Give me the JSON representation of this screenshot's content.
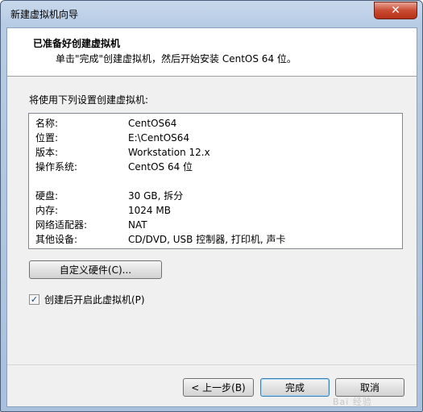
{
  "window": {
    "title": "新建虚拟机向导"
  },
  "header": {
    "title": "已准备好创建虚拟机",
    "subtitle": "单击\"完成\"创建虚拟机，然后开始安装 CentOS 64 位。"
  },
  "intro": "将使用下列设置创建虚拟机:",
  "settings": [
    {
      "label": "名称:",
      "value": "CentOS64"
    },
    {
      "label": "位置:",
      "value": "E:\\CentOS64"
    },
    {
      "label": "版本:",
      "value": "Workstation 12.x"
    },
    {
      "label": "操作系统:",
      "value": "CentOS 64 位"
    },
    {
      "label": "硬盘:",
      "value": "30 GB, 拆分"
    },
    {
      "label": "内存:",
      "value": "1024 MB"
    },
    {
      "label": "网络适配器:",
      "value": "NAT"
    },
    {
      "label": "其他设备:",
      "value": "CD/DVD, USB 控制器, 打印机, 声卡"
    }
  ],
  "buttons": {
    "customize_hw": "自定义硬件(C)...",
    "back": "< 上一步(B)",
    "finish": "完成",
    "cancel": "取消"
  },
  "checkbox": {
    "label": "创建后开启此虚拟机(P)",
    "checked": true
  },
  "watermark": "Bai 经验"
}
